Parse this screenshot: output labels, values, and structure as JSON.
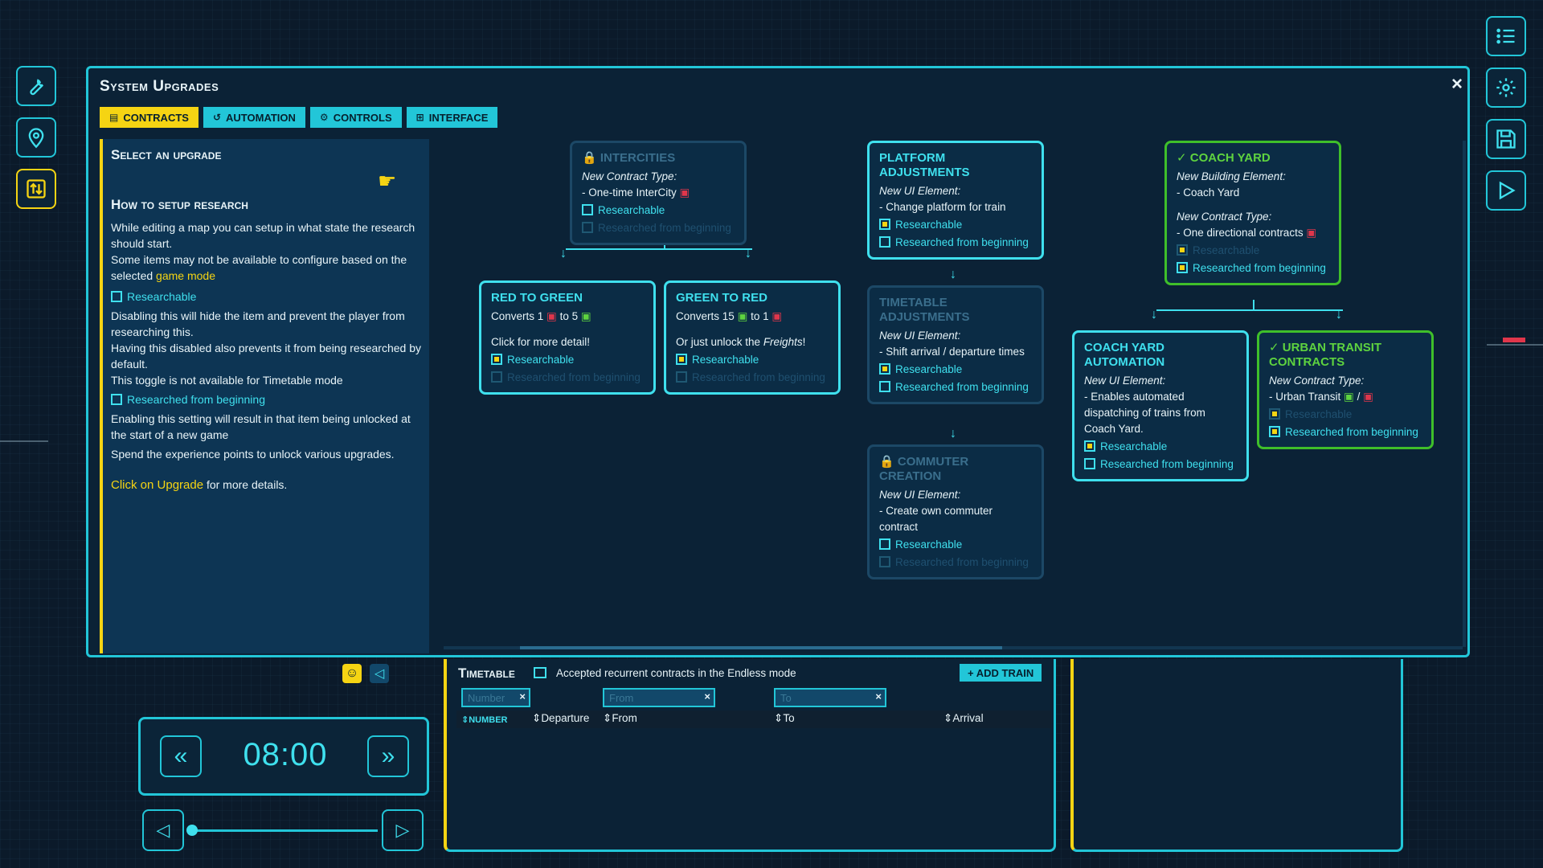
{
  "modal": {
    "title": "System Upgrades",
    "close": "×",
    "tabs": [
      {
        "label": "Contracts",
        "icon": "document-icon",
        "active": true
      },
      {
        "label": "Automation",
        "icon": "history-icon",
        "active": false
      },
      {
        "label": "Controls",
        "icon": "gears-icon",
        "active": false
      },
      {
        "label": "Interface",
        "icon": "hierarchy-icon",
        "active": false
      }
    ]
  },
  "left_panel": {
    "heading": "Select an upgrade",
    "research_heading": "How to setup research",
    "p1": "While editing a map you can setup in what state the research should start.",
    "p2a": "Some items may not be available to configure based on the selected ",
    "p2b": "game mode",
    "researchable_label": "Researchable",
    "p3": "Disabling this will hide the item and prevent the player from researching this.",
    "p4": "Having this disabled also prevents it from being researched by default.",
    "p5": "This toggle is not available for Timetable mode",
    "researched_label": "Researched from beginning",
    "p6": "Enabling this setting will result in that item being unlocked at the start of a new game",
    "p7": "Spend the experience points to unlock various upgrades.",
    "p8a": "Click on Upgrade",
    "p8b": " for more details."
  },
  "cards": {
    "intercities": {
      "title": "Intercities",
      "type": "New Contract Type:",
      "desc": "- One-time InterCity",
      "cb1": "Researchable",
      "cb2": "Researched from beginning"
    },
    "red_to_green": {
      "title": "Red to Green",
      "l1a": "Converts 1",
      "l1b": "to 5",
      "l2": "Click for more detail!",
      "cb1": "Researchable",
      "cb2": "Researched from beginning"
    },
    "green_to_red": {
      "title": "Green to Red",
      "l1a": "Converts 15",
      "l1b": "to 1",
      "l2a": "Or just unlock the ",
      "l2b": "Freights",
      "l2c": "!",
      "cb1": "Researchable",
      "cb2": "Researched from beginning"
    },
    "platform": {
      "title1": "Platform",
      "title2": "Adjustments",
      "type": "New UI Element:",
      "desc": "- Change platform for train",
      "cb1": "Researchable",
      "cb2": "Researched from beginning"
    },
    "timetable_adj": {
      "title1": "Timetable",
      "title2": "Adjustments",
      "type": "New UI Element:",
      "desc": "- Shift arrival / departure times",
      "cb1": "Researchable",
      "cb2": "Researched from beginning"
    },
    "commuter": {
      "title": "Commuter Creation",
      "type": "New UI Element:",
      "desc": "- Create own commuter contract",
      "cb1": "Researchable",
      "cb2": "Researched from beginning"
    },
    "coach_yard": {
      "title": "Coach Yard",
      "type": "New Building Element:",
      "desc": "- Coach Yard",
      "type2": "New Contract Type:",
      "desc2": "- One directional contracts",
      "cb1": "Researchable",
      "cb2": "Researched from beginning"
    },
    "coach_auto": {
      "title1": "Coach Yard",
      "title2": "Automation",
      "type": "New UI Element:",
      "desc": "- Enables automated dispatching of trains from Coach Yard.",
      "cb1": "Researchable",
      "cb2": "Researched from beginning"
    },
    "urban": {
      "title1": "Urban Transit",
      "title2": "Contracts",
      "type": "New Contract Type:",
      "desc": "- Urban Transit",
      "desc_sep": "/",
      "cb1": "Researchable",
      "cb2": "Researched from beginning"
    }
  },
  "time": {
    "clock": "08:00"
  },
  "timetable": {
    "title": "Timetable",
    "desc": "Accepted recurrent contracts in the Endless mode",
    "add_train": "+ ADD TRAIN",
    "filters": {
      "number": "Number",
      "from": "From",
      "to": "To"
    },
    "columns": [
      "NUMBER",
      "Departure",
      "From",
      "To",
      "Arrival"
    ]
  },
  "colors": {
    "accent": "#22c6d8",
    "active": "#f5d413",
    "done": "#3fbf2a",
    "locked": "#e0364b"
  }
}
